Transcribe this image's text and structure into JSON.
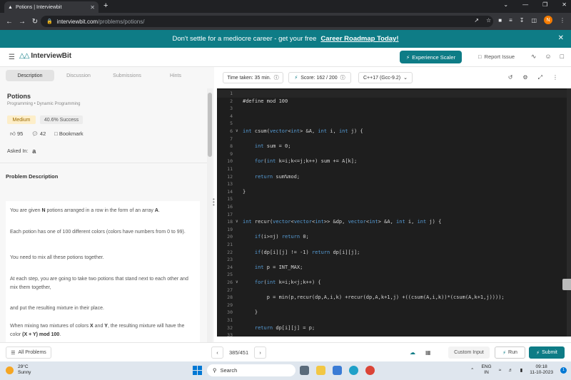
{
  "browser": {
    "tab_title": "Potions | Interviewbit",
    "url_host": "interviewbit.com",
    "url_path": "/problems/potions/",
    "profile_initial": "N"
  },
  "banner": {
    "text": "Don't settle for a mediocre career - get your free",
    "link": "Career Roadmap Today!"
  },
  "header": {
    "logo": "InterviewBit",
    "experience_btn": "Experience Scaler",
    "report": "Report Issue"
  },
  "problem": {
    "tabs": [
      "Description",
      "Discussion",
      "Submissions",
      "Hints"
    ],
    "title": "Potions",
    "breadcrumb": "Programming • Dynamic Programming",
    "difficulty": "Medium",
    "success": "40.6% Success",
    "likes": "95",
    "comments": "42",
    "bookmark": "Bookmark",
    "asked_in": "Asked In:",
    "company_logo": "a",
    "section_title": "Problem Description",
    "paragraphs": [
      [
        "You are given ",
        "N",
        " potions arranged in a row in the form of an array ",
        "A",
        "."
      ],
      [
        "Each potion has one of 100 different colors (colors have numbers from 0 to 99)."
      ],
      [
        "You need to mix all these potions together."
      ],
      [
        "At each step, you are going to take two potions that stand next to each other and mix them together,"
      ],
      [
        "and put the resulting mixture in their place."
      ],
      [
        "When mixing two mixtures of colors ",
        "X",
        " and ",
        "Y",
        ", the resulting mixture will have the color ",
        "(X + Y) mod 100",
        "."
      ]
    ]
  },
  "toolbar": {
    "time": "Time taken: 35 min.",
    "score": "Score:  162 / 200",
    "language": "C++17 (Gcc-9.2)"
  },
  "code_lines": [
    {
      "n": "1",
      "t": ""
    },
    {
      "n": "2",
      "t": "#define mod 100"
    },
    {
      "n": "3",
      "t": ""
    },
    {
      "n": "4",
      "t": ""
    },
    {
      "n": "5",
      "t": ""
    },
    {
      "n": "6",
      "t": "int csum(vector<int> &A, int i, int j) {",
      "fold": true
    },
    {
      "n": "7",
      "t": ""
    },
    {
      "n": "8",
      "t": "    int sum = 0;"
    },
    {
      "n": "9",
      "t": ""
    },
    {
      "n": "10",
      "t": "    for(int k=i;k<=j;k++) sum += A[k];"
    },
    {
      "n": "11",
      "t": ""
    },
    {
      "n": "12",
      "t": "    return sum%mod;"
    },
    {
      "n": "13",
      "t": ""
    },
    {
      "n": "14",
      "t": "}"
    },
    {
      "n": "15",
      "t": ""
    },
    {
      "n": "16",
      "t": ""
    },
    {
      "n": "17",
      "t": ""
    },
    {
      "n": "18",
      "t": "int recur(vector<vector<int>> &dp, vector<int> &A, int i, int j) {",
      "fold": true
    },
    {
      "n": "19",
      "t": ""
    },
    {
      "n": "20",
      "t": "    if(i>=j) return 0;"
    },
    {
      "n": "21",
      "t": ""
    },
    {
      "n": "22",
      "t": "    if(dp[i][j] != -1) return dp[i][j];"
    },
    {
      "n": "23",
      "t": ""
    },
    {
      "n": "24",
      "t": "    int p = INT_MAX;"
    },
    {
      "n": "25",
      "t": ""
    },
    {
      "n": "26",
      "t": "    for(int k=i;k<j;k++) {",
      "fold": true
    },
    {
      "n": "27",
      "t": ""
    },
    {
      "n": "28",
      "t": "        p = min(p,recur(dp,A,i,k) +recur(dp,A,k+1,j) +((csum(A,i,k))*(csum(A,k+1,j))));"
    },
    {
      "n": "29",
      "t": ""
    },
    {
      "n": "30",
      "t": "    }"
    },
    {
      "n": "31",
      "t": ""
    },
    {
      "n": "32",
      "t": "    return dp[i][j] = p;"
    },
    {
      "n": "33",
      "t": ""
    }
  ],
  "footer": {
    "all_problems": "All Problems",
    "counter": "385/451",
    "custom_input": "Custom Input",
    "run": "Run",
    "submit": "Submit"
  },
  "taskbar": {
    "temp": "29°C",
    "weather": "Sunny",
    "search": "Search",
    "lang1": "ENG",
    "lang2": "IN",
    "time": "09:18",
    "date": "11-10-2023"
  }
}
